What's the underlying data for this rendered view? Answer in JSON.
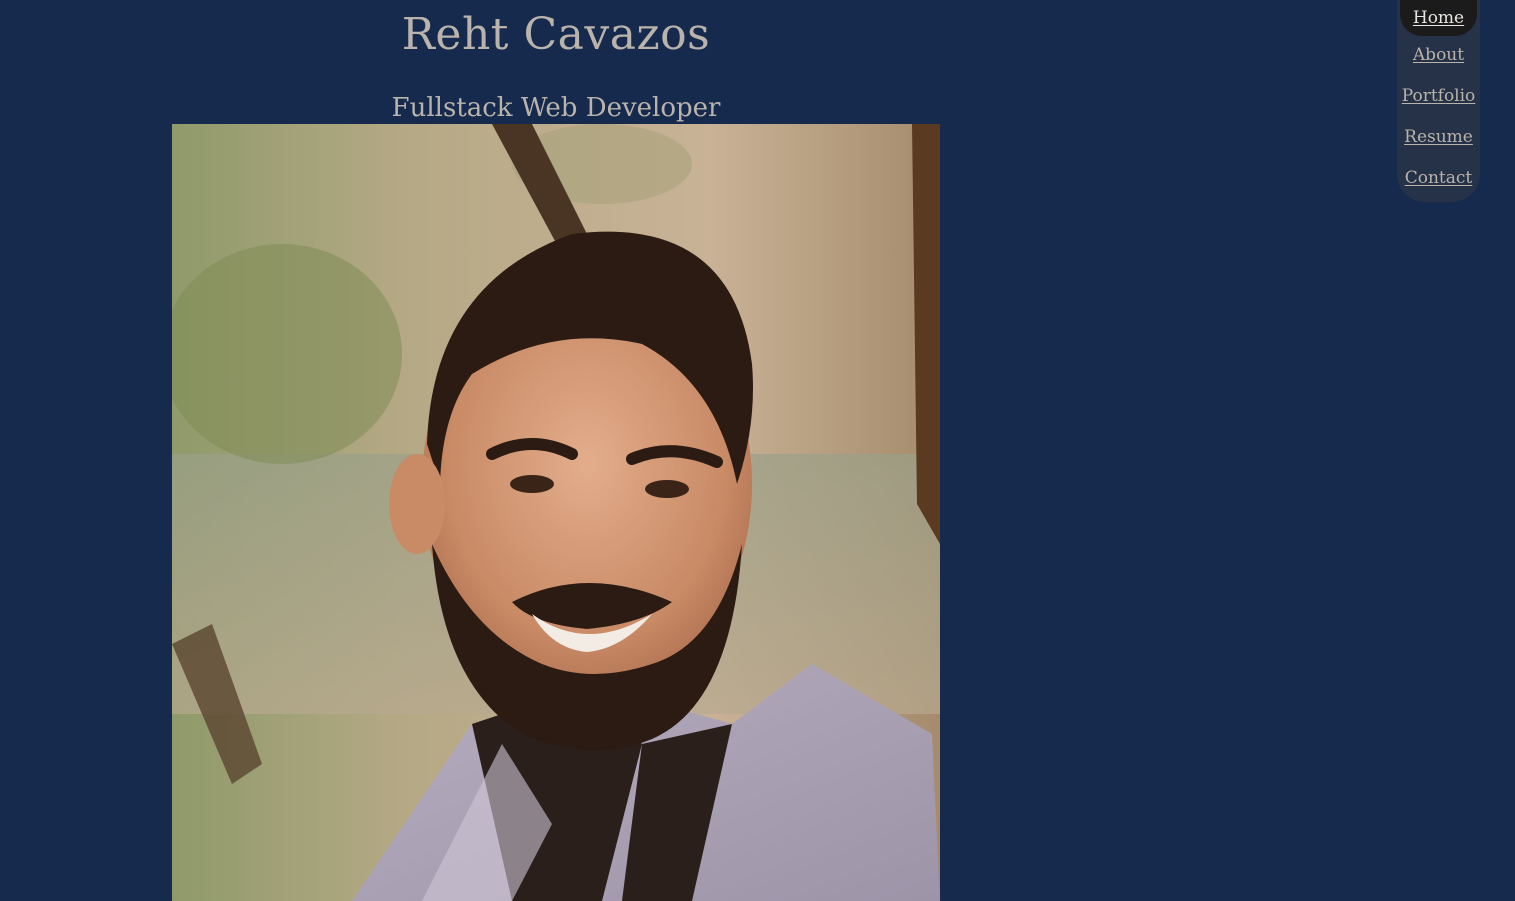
{
  "header": {
    "name": "Reht Cavazos",
    "subtitle": "Fullstack Web Developer"
  },
  "nav": {
    "items": [
      {
        "label": "Home",
        "active": true
      },
      {
        "label": "About",
        "active": false
      },
      {
        "label": "Portfolio",
        "active": false
      },
      {
        "label": "Resume",
        "active": false
      },
      {
        "label": "Contact",
        "active": false
      }
    ]
  },
  "colors": {
    "background": "#162a4e",
    "text": "#b9b3ab",
    "nav_background": "#263248",
    "nav_active_background": "#1b1b1b"
  }
}
